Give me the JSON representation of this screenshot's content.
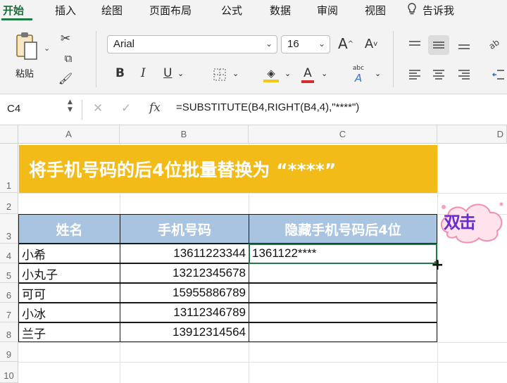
{
  "menu": {
    "tabs": [
      "开始",
      "插入",
      "绘图",
      "页面布局",
      "公式",
      "数据",
      "审阅",
      "视图"
    ],
    "tell_me": "告诉我"
  },
  "ribbon": {
    "paste_label": "粘贴",
    "font_name": "Arial",
    "font_size": "16",
    "bold": "B",
    "italic": "I",
    "underline": "U",
    "font_color_glyph": "A",
    "grow_font": "A",
    "shrink_font": "A",
    "phonetic_glyph": "abc",
    "accent_color": "#1f7a45",
    "highlight_color": "#f5c518",
    "font_color": "#d32f2f"
  },
  "formula_bar": {
    "cell_ref": "C4",
    "fx": "fx",
    "formula": "=SUBSTITUTE(B4,RIGHT(B4,4),\"****\")"
  },
  "sheet": {
    "columns": [
      "A",
      "B",
      "C",
      "D"
    ],
    "rows": [
      "1",
      "2",
      "3",
      "4",
      "5",
      "6",
      "7",
      "8",
      "9",
      "10"
    ],
    "title": "将手机号码的后4位批量替换为 “****”",
    "headers": [
      "姓名",
      "手机号码",
      "隐藏手机号码后4位"
    ],
    "data": [
      {
        "name": "小希",
        "phone": "13611223344",
        "masked": "1361122****"
      },
      {
        "name": "小丸子",
        "phone": "13212345678",
        "masked": ""
      },
      {
        "name": "可可",
        "phone": "15955886789",
        "masked": ""
      },
      {
        "name": "小冰",
        "phone": "13112346789",
        "masked": ""
      },
      {
        "name": "兰子",
        "phone": "13912314564",
        "masked": ""
      }
    ],
    "banner_color": "#f3bb18",
    "header_color": "#a9c4e0"
  },
  "sticker_text": "双击"
}
